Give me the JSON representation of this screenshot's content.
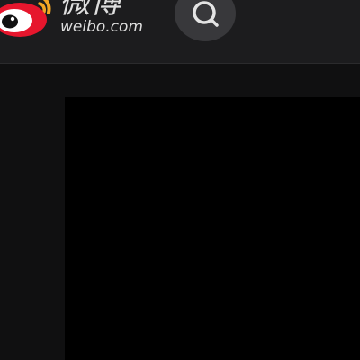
{
  "header": {
    "logo": {
      "text_cn": "微博",
      "text_en": "weibo.com",
      "icon": "weibo-logo-icon"
    },
    "search": {
      "icon": "search-icon"
    }
  },
  "colors": {
    "page_background": "#101011",
    "header_background": "#1c1c1e",
    "search_button_background": "#38383b",
    "content_panel_background": "#000000",
    "logo_red": "#e6162d",
    "logo_orange": "#f5a623",
    "text_light": "#dedede"
  }
}
